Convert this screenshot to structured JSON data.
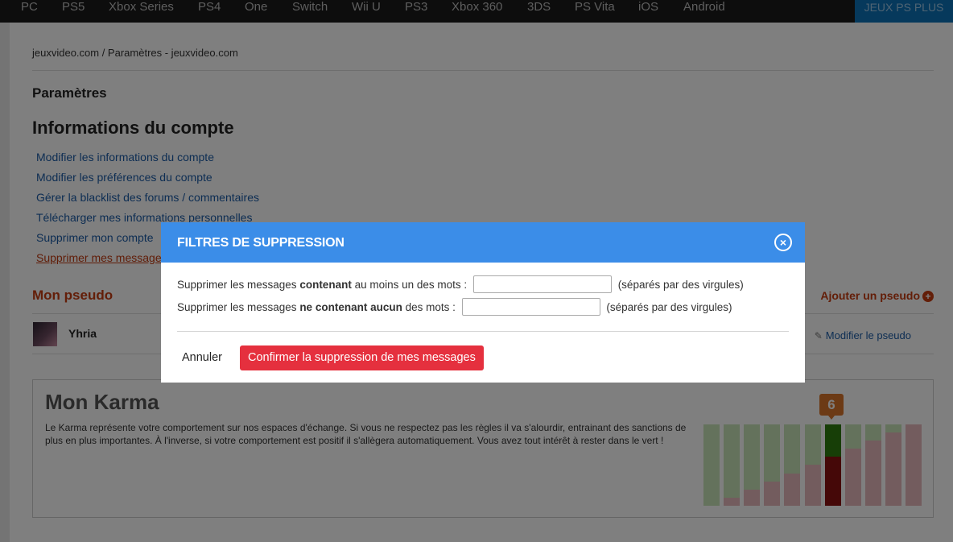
{
  "nav": {
    "items": [
      "PC",
      "PS5",
      "Xbox Series",
      "PS4",
      "One",
      "Switch",
      "Wii U",
      "PS3",
      "Xbox 360",
      "3DS",
      "PS Vita",
      "iOS",
      "Android"
    ],
    "ps_plus": "JEUX PS PLUS"
  },
  "breadcrumb": "jeuxvideo.com / Paramètres - jeuxvideo.com",
  "params_title": "Paramètres",
  "account": {
    "title": "Informations du compte",
    "links": [
      "Modifier les informations du compte",
      "Modifier les préférences du compte",
      "Gérer la blacklist des forums / commentaires",
      "Télécharger mes informations personnelles",
      "Supprimer mon compte",
      "Supprimer mes messages"
    ]
  },
  "pseudo": {
    "title": "Mon pseudo",
    "add_label": "Ajouter un pseudo",
    "name": "Yhria",
    "edit_label": "Modifier le pseudo"
  },
  "karma": {
    "title": "Mon Karma",
    "text": "Le Karma représente votre comportement sur nos espaces d'échange. Si vous ne respectez pas les règles il va s'alourdir, entrainant des sanctions de plus en plus importantes. À l'inverse, si votre comportement est positif il s'allègera automatiquement. Vous avez tout intérêt à rester dans le vert !",
    "level": "6",
    "current_index": 6,
    "red_heights": [
      0,
      10,
      20,
      30,
      40,
      50,
      60,
      70,
      80,
      90,
      100
    ],
    "green_color": "#2e7d0e",
    "red_color": "#8b1010"
  },
  "modal": {
    "title": "FILTRES DE SUPPRESSION",
    "line1": {
      "prefix": "Supprimer les messages ",
      "bold": "contenant",
      "suffix": " au moins un des mots :",
      "value": "",
      "note": "(séparés par des virgules)"
    },
    "line2": {
      "prefix": "Supprimer les messages ",
      "bold": "ne contenant aucun",
      "suffix": " des mots :",
      "value": "",
      "note": "(séparés par des virgules)"
    },
    "cancel": "Annuler",
    "confirm": "Confirmer la suppression de mes messages"
  }
}
